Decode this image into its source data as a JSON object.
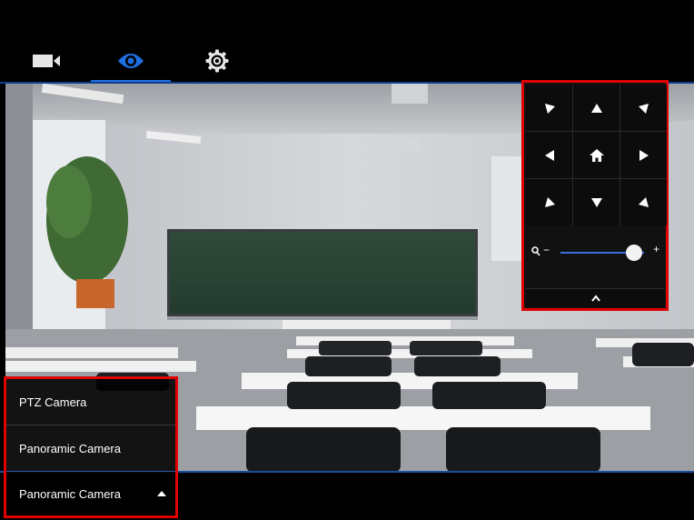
{
  "top_tabs": [
    {
      "name": "camera",
      "icon": "video-camera-icon",
      "active": false
    },
    {
      "name": "view",
      "icon": "eye-icon",
      "active": true
    },
    {
      "name": "settings",
      "icon": "gear-icon",
      "active": false
    }
  ],
  "colors": {
    "accent": "#1e6fe0",
    "highlight_border": "#e00000",
    "background": "#000000"
  },
  "video": {
    "content": "classroom-camera-feed"
  },
  "ptz": {
    "buttons": [
      {
        "name": "ptz-up-left",
        "icon": "arrow-up-left-icon"
      },
      {
        "name": "ptz-up",
        "icon": "arrow-up-icon"
      },
      {
        "name": "ptz-up-right",
        "icon": "arrow-up-right-icon"
      },
      {
        "name": "ptz-left",
        "icon": "arrow-left-icon"
      },
      {
        "name": "ptz-home",
        "icon": "home-icon"
      },
      {
        "name": "ptz-right",
        "icon": "arrow-right-icon"
      },
      {
        "name": "ptz-down-left",
        "icon": "arrow-down-left-icon"
      },
      {
        "name": "ptz-down",
        "icon": "arrow-down-icon"
      },
      {
        "name": "ptz-down-right",
        "icon": "arrow-down-right-icon"
      }
    ],
    "zoom": {
      "minus": "−",
      "plus": "+",
      "level": 0.88
    },
    "collapse_icon": "chevron-up-icon"
  },
  "camera_menu": {
    "options": [
      "PTZ Camera",
      "Panoramic Camera"
    ],
    "selected": "Panoramic Camera"
  }
}
